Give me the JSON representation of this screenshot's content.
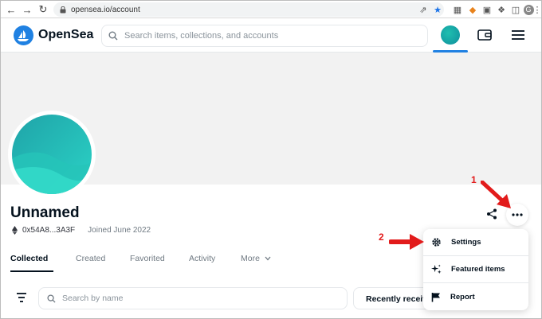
{
  "browser": {
    "url": "opensea.io/account"
  },
  "header": {
    "brand": "OpenSea",
    "search_placeholder": "Search items, collections, and accounts"
  },
  "profile": {
    "name": "Unnamed",
    "address": "0x54A8...3A3F",
    "joined": "Joined June 2022"
  },
  "tabs": [
    {
      "label": "Collected"
    },
    {
      "label": "Created"
    },
    {
      "label": "Favorited"
    },
    {
      "label": "Activity"
    },
    {
      "label": "More"
    }
  ],
  "filters": {
    "search_placeholder": "Search by name",
    "sort_label": "Recently received"
  },
  "dropdown": {
    "items": [
      {
        "label": "Settings",
        "icon": "gear-icon"
      },
      {
        "label": "Featured items",
        "icon": "sparkle-icon"
      },
      {
        "label": "Report",
        "icon": "flag-icon"
      }
    ]
  },
  "annotations": {
    "step1": "1",
    "step2": "2",
    "color": "#e21b1b"
  },
  "colors": {
    "accent": "#2081e2",
    "text": "#04111d",
    "muted": "#707a83"
  }
}
